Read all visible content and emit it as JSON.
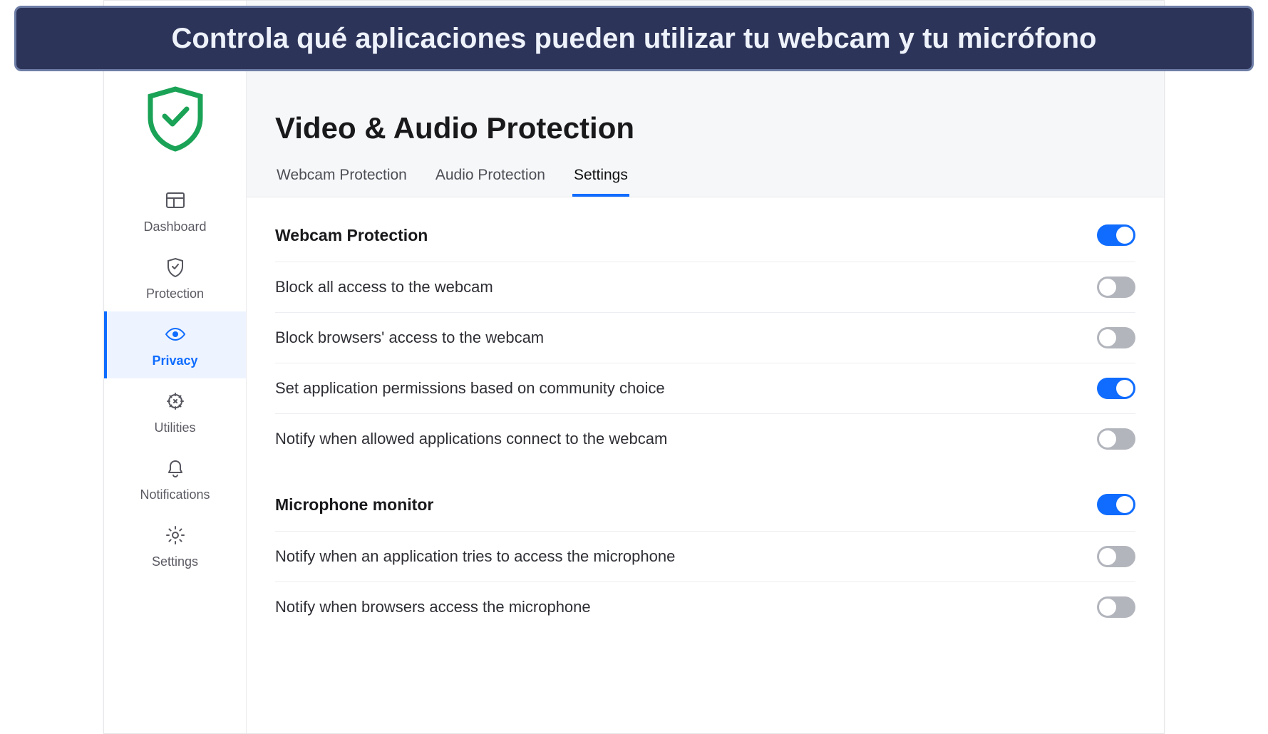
{
  "banner": {
    "text": "Controla qué aplicaciones pueden utilizar tu webcam y tu micrófono"
  },
  "sidebar": {
    "items": [
      {
        "label": "Dashboard",
        "icon": "dashboard",
        "active": false
      },
      {
        "label": "Protection",
        "icon": "shield",
        "active": false
      },
      {
        "label": "Privacy",
        "icon": "eye",
        "active": true
      },
      {
        "label": "Utilities",
        "icon": "tools",
        "active": false
      },
      {
        "label": "Notifications",
        "icon": "bell",
        "active": false
      },
      {
        "label": "Settings",
        "icon": "gear",
        "active": false
      }
    ]
  },
  "header": {
    "title": "Video & Audio Protection",
    "tabs": [
      {
        "label": "Webcam Protection",
        "active": false
      },
      {
        "label": "Audio Protection",
        "active": false
      },
      {
        "label": "Settings",
        "active": true
      }
    ]
  },
  "sections": [
    {
      "title": "Webcam Protection",
      "master_toggle": true,
      "rows": [
        {
          "label": "Block all access to the webcam",
          "on": false
        },
        {
          "label": "Block browsers' access to the webcam",
          "on": false
        },
        {
          "label": "Set application permissions based on community choice",
          "on": true
        },
        {
          "label": "Notify when allowed applications connect to the webcam",
          "on": false
        }
      ]
    },
    {
      "title": "Microphone monitor",
      "master_toggle": true,
      "rows": [
        {
          "label": "Notify when an application tries to access the microphone",
          "on": false
        },
        {
          "label": "Notify when browsers access the microphone",
          "on": false
        }
      ]
    }
  ],
  "colors": {
    "accent": "#0f6cff",
    "banner_bg": "#2d3459",
    "banner_border": "#6d7da6"
  }
}
